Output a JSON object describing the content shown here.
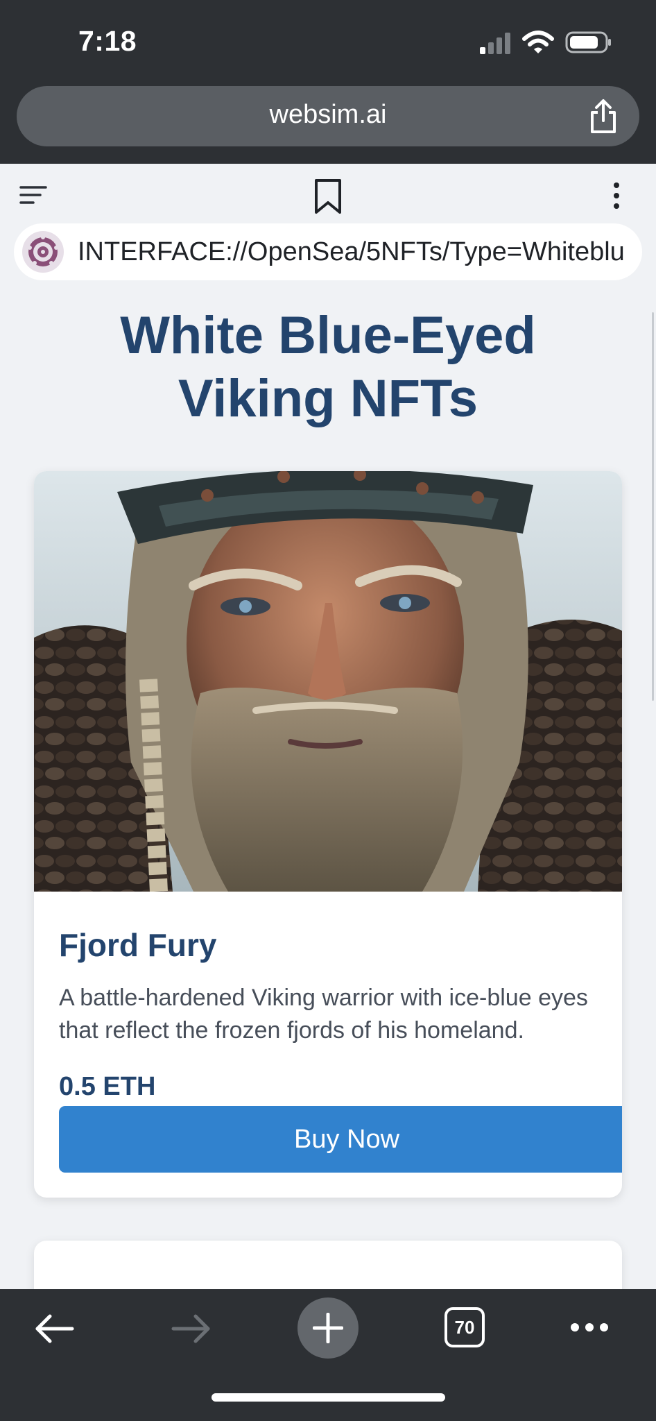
{
  "status_bar": {
    "time": "7:18",
    "icons": [
      "signal-icon",
      "wifi-icon",
      "battery-icon"
    ]
  },
  "browser": {
    "url": "websim.ai",
    "share_icon": "share-icon",
    "bottom_toolbar": {
      "back_icon": "back-arrow-icon",
      "forward_icon": "forward-arrow-icon",
      "new_tab_icon": "plus-icon",
      "tab_count": "70",
      "more_icon": "more-horizontal-icon"
    }
  },
  "site_toolbar": {
    "menu_icon": "menu-icon",
    "bookmark_icon": "bookmark-icon",
    "more_icon": "more-vertical-icon",
    "address": "INTERFACE://OpenSea/5NFTs/Type=Whiteblu"
  },
  "page": {
    "title_line1": "White Blue-Eyed",
    "title_line2": "Viking NFTs"
  },
  "nft_cards": [
    {
      "name": "Fjord Fury",
      "description": "A battle-hardened Viking warrior with ice-blue eyes that reflect the frozen fjords of his homeland.",
      "price": "0.5 ETH",
      "button_label": "Buy Now"
    }
  ],
  "colors": {
    "chrome_background": "#2d3034",
    "page_background": "#f0f2f5",
    "heading": "#23446d",
    "button": "#3182ce"
  }
}
